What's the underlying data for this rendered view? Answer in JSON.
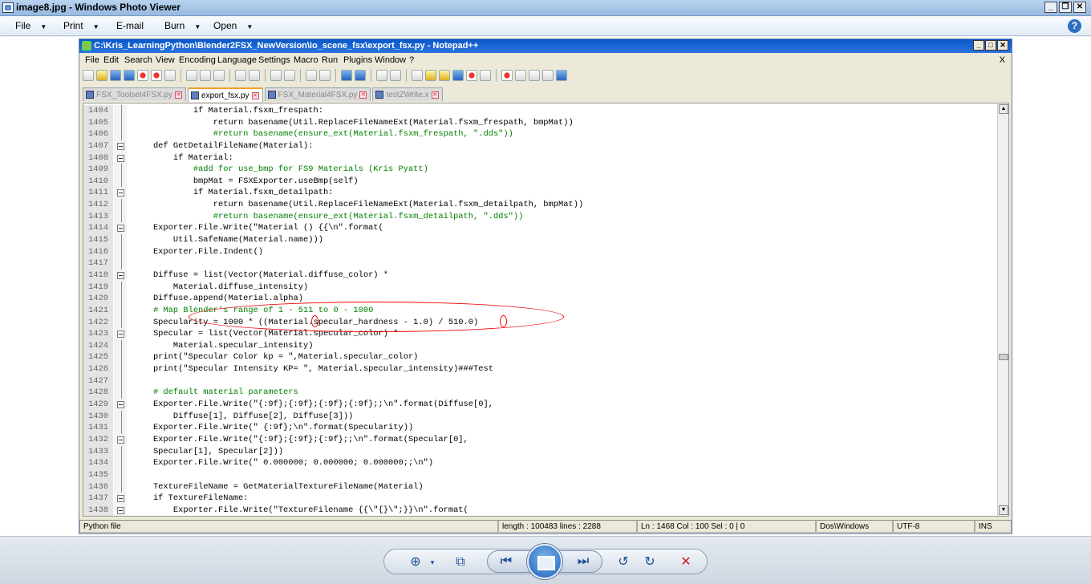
{
  "photo_viewer": {
    "title": "image8.jpg - Windows Photo Viewer",
    "menu": [
      "File",
      "Print",
      "E-mail",
      "Burn",
      "Open"
    ],
    "help": "?"
  },
  "npp": {
    "title": "C:\\Kris_LearningPython\\Blender2FSX_NewVersion\\io_scene_fsx\\export_fsx.py - Notepad++",
    "menu": [
      "File",
      "Edit",
      "Search",
      "View",
      "Encoding",
      "Language",
      "Settings",
      "Macro",
      "Run",
      "Plugins",
      "Window",
      "?"
    ],
    "menu_close": "X",
    "tabs": [
      {
        "label": "FSX_Toolset4FSX.py",
        "active": false
      },
      {
        "label": "export_fsx.py",
        "active": true
      },
      {
        "label": "FSX_Material4FSX.py",
        "active": false
      },
      {
        "label": "testZWrite.x",
        "active": false
      }
    ],
    "lines": [
      {
        "n": "1404",
        "t": "            if Material.fsxm_frespath:",
        "c": false
      },
      {
        "n": "1405",
        "t": "                return basename(Util.ReplaceFileNameExt(Material.fsxm_frespath, bmpMat))",
        "c": false
      },
      {
        "n": "1406",
        "t": "                #return basename(ensure_ext(Material.fsxm_frespath, \".dds\"))",
        "c": true
      },
      {
        "n": "1407",
        "t": "    def GetDetailFileName(Material):",
        "c": false
      },
      {
        "n": "1408",
        "t": "        if Material:",
        "c": false
      },
      {
        "n": "1409",
        "t": "            #add for use_bmp for FS9 Materials (Kris Pyatt)",
        "c": true
      },
      {
        "n": "1410",
        "t": "            bmpMat = FSXExporter.useBmp(self)",
        "c": false
      },
      {
        "n": "1411",
        "t": "            if Material.fsxm_detailpath:",
        "c": false
      },
      {
        "n": "1412",
        "t": "                return basename(Util.ReplaceFileNameExt(Material.fsxm_detailpath, bmpMat))",
        "c": false
      },
      {
        "n": "1413",
        "t": "                #return basename(ensure_ext(Material.fsxm_detailpath, \".dds\"))",
        "c": true
      },
      {
        "n": "1414",
        "t": "    Exporter.File.Write(\"Material () {{\\n\".format(",
        "c": false
      },
      {
        "n": "1415",
        "t": "        Util.SafeName(Material.name)))",
        "c": false
      },
      {
        "n": "1416",
        "t": "    Exporter.File.Indent()",
        "c": false
      },
      {
        "n": "1417",
        "t": "",
        "c": false
      },
      {
        "n": "1418",
        "t": "    Diffuse = list(Vector(Material.diffuse_color) *",
        "c": false
      },
      {
        "n": "1419",
        "t": "        Material.diffuse_intensity)",
        "c": false
      },
      {
        "n": "1420",
        "t": "    Diffuse.append(Material.alpha)",
        "c": false
      },
      {
        "n": "1421",
        "t": "    # Map Blender's range of 1 - 511 to 0 - 1000",
        "c": true
      },
      {
        "n": "1422",
        "t": "    Specularity = 1000 * ((Material.specular_hardness - 1.0) / 510.0)",
        "c": false
      },
      {
        "n": "1423",
        "t": "    Specular = list(Vector(Material.specular_color) *",
        "c": false
      },
      {
        "n": "1424",
        "t": "        Material.specular_intensity)",
        "c": false
      },
      {
        "n": "1425",
        "t": "    print(\"Specular Color kp = \",Material.specular_color)",
        "c": false
      },
      {
        "n": "1426",
        "t": "    print(\"Specular Intensity KP= \", Material.specular_intensity)###Test",
        "c": false
      },
      {
        "n": "1427",
        "t": "",
        "c": false
      },
      {
        "n": "1428",
        "t": "    # default material parameters",
        "c": true
      },
      {
        "n": "1429",
        "t": "    Exporter.File.Write(\"{:9f};{:9f};{:9f};{:9f};;\\n\".format(Diffuse[0],",
        "c": false
      },
      {
        "n": "1430",
        "t": "        Diffuse[1], Diffuse[2], Diffuse[3]))",
        "c": false
      },
      {
        "n": "1431",
        "t": "    Exporter.File.Write(\" {:9f};\\n\".format(Specularity))",
        "c": false
      },
      {
        "n": "1432",
        "t": "    Exporter.File.Write(\"{:9f};{:9f};{:9f};;\\n\".format(Specular[0],",
        "c": false
      },
      {
        "n": "1433",
        "t": "    Specular[1], Specular[2]))",
        "c": false
      },
      {
        "n": "1434",
        "t": "    Exporter.File.Write(\" 0.000000; 0.000000; 0.000000;;\\n\")",
        "c": false
      },
      {
        "n": "1435",
        "t": "",
        "c": false
      },
      {
        "n": "1436",
        "t": "    TextureFileName = GetMaterialTextureFileName(Material)",
        "c": false
      },
      {
        "n": "1437",
        "t": "    if TextureFileName:",
        "c": false
      },
      {
        "n": "1438",
        "t": "        Exporter.File.Write(\"TextureFilename {{\\\"{}\\\";}}\\n\".format(",
        "c": false
      }
    ],
    "status": {
      "lang": "Python file",
      "length": "length : 100483    lines : 2288",
      "pos": "Ln : 1468    Col : 100    Sel : 0 | 0",
      "eol": "Dos\\Windows",
      "enc": "UTF-8",
      "mode": "INS"
    }
  },
  "colors": {
    "comment": "#008000",
    "annotation": "#e00000",
    "title_bar": "#0a57c8"
  }
}
